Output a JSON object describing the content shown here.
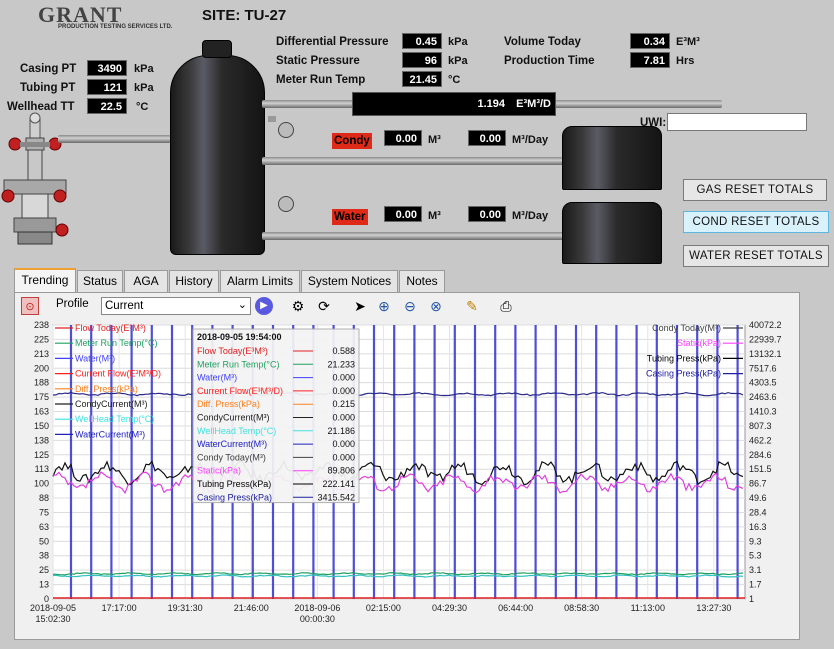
{
  "header": {
    "logo_text": "GRANT",
    "logo_sub": "PRODUCTION TESTING SERVICES LTD.",
    "site": "SITE: TU-27"
  },
  "wellhead": {
    "casing_pt": {
      "label": "Casing PT",
      "value": "3490",
      "unit": "kPa"
    },
    "tubing_pt": {
      "label": "Tubing PT",
      "value": "121",
      "unit": "kPa"
    },
    "wellhead_tt": {
      "label": "Wellhead TT",
      "value": "22.5",
      "unit": "°C"
    }
  },
  "meter": {
    "diff_pressure": {
      "label": "Differential Pressure",
      "value": "0.45",
      "unit": "kPa"
    },
    "static_pressure": {
      "label": "Static Pressure",
      "value": "96",
      "unit": "kPa"
    },
    "run_temp": {
      "label": "Meter Run Temp",
      "value": "21.45",
      "unit": "°C"
    },
    "volume_today": {
      "label": "Volume Today",
      "value": "0.34",
      "unit": "E³M³"
    },
    "production_time": {
      "label": "Production Time",
      "value": "7.81",
      "unit": "Hrs"
    },
    "flow_rate": {
      "value": "1.194",
      "unit": "E³M³/D"
    }
  },
  "condy": {
    "label": "Condy",
    "volume": "0.00",
    "volume_unit": "M³",
    "rate": "0.00",
    "rate_unit": "M³/Day"
  },
  "water": {
    "label": "Water",
    "volume": "0.00",
    "volume_unit": "M³",
    "rate": "0.00",
    "rate_unit": "M³/Day"
  },
  "uwi": {
    "label": "UWI:",
    "value": ""
  },
  "buttons": {
    "gas_reset": "GAS RESET TOTALS",
    "cond_reset": "COND RESET TOTALS",
    "water_reset": "WATER RESET TOTALS"
  },
  "tabs": [
    "Trending",
    "Status",
    "AGA",
    "History",
    "Alarm Limits",
    "System Notices",
    "Notes"
  ],
  "toolbar": {
    "profile_label": "Profile",
    "profile_value": "Current"
  },
  "chart_data": {
    "type": "line",
    "left_axis_ticks": [
      "238",
      "225",
      "213",
      "200",
      "188",
      "175",
      "163",
      "150",
      "138",
      "125",
      "113",
      "100",
      "88",
      "75",
      "63",
      "50",
      "38",
      "25",
      "13",
      "0"
    ],
    "right_axis_ticks": [
      "40072.2",
      "22939.7",
      "13132.1",
      "7517.6",
      "4303.5",
      "2463.6",
      "1410.3",
      "807.3",
      "462.2",
      "284.6",
      "151.5",
      "86.7",
      "49.6",
      "28.4",
      "16.3",
      "9.3",
      "5.3",
      "3.1",
      "1.7",
      "1"
    ],
    "x_ticks": [
      {
        "line1": "2018-09-05",
        "line2": "15:02:30"
      },
      {
        "line1": "17:17:00",
        "line2": ""
      },
      {
        "line1": "19:31:30",
        "line2": ""
      },
      {
        "line1": "21:46:00",
        "line2": ""
      },
      {
        "line1": "2018-09-06",
        "line2": "00:00:30"
      },
      {
        "line1": "02:15:00",
        "line2": ""
      },
      {
        "line1": "04:29:30",
        "line2": ""
      },
      {
        "line1": "06:44:00",
        "line2": ""
      },
      {
        "line1": "08:58:30",
        "line2": ""
      },
      {
        "line1": "11:13:00",
        "line2": ""
      },
      {
        "line1": "13:27:30",
        "line2": ""
      }
    ],
    "left_legend": [
      {
        "name": "Flow Today(E³M³)",
        "color": "#e02020"
      },
      {
        "name": "Meter Run Temp(°C)",
        "color": "#20a060"
      },
      {
        "name": "Water(M³)",
        "color": "#4040ff"
      },
      {
        "name": "Current Flow(E³M³/D)",
        "color": "#ff2020"
      },
      {
        "name": "Diff. Press(kPa)",
        "color": "#ff8020"
      },
      {
        "name": "CondyCurrent(M³)",
        "color": "#202020"
      },
      {
        "name": "WellHead Temp(°C)",
        "color": "#40e0e0"
      },
      {
        "name": "WaterCurrent(M³)",
        "color": "#2020c0"
      }
    ],
    "right_legend": [
      {
        "name": "Condy Today(M³)",
        "color": "#404040"
      },
      {
        "name": "Static(kPa)",
        "color": "#ff40ff"
      },
      {
        "name": "Tubing Press(kPa)",
        "color": "#000000"
      },
      {
        "name": "Casing Press(kPa)",
        "color": "#2020a0"
      }
    ],
    "tooltip": {
      "timestamp": "2018-09-05 19:54:00",
      "rows": [
        {
          "name": "Flow Today(E³M³)",
          "value": "0.588",
          "color": "#e02020"
        },
        {
          "name": "Meter Run Temp(°C)",
          "value": "21.233",
          "color": "#20a060"
        },
        {
          "name": "Water(M³)",
          "value": "0.000",
          "color": "#4040ff"
        },
        {
          "name": "Current Flow(E³M³/D)",
          "value": "0.000",
          "color": "#ff2020"
        },
        {
          "name": "Diff. Press(kPa)",
          "value": "0.215",
          "color": "#ff8020"
        },
        {
          "name": "CondyCurrent(M³)",
          "value": "0.000",
          "color": "#202020"
        },
        {
          "name": "WellHead Temp(°C)",
          "value": "21.186",
          "color": "#40e0e0"
        },
        {
          "name": "WaterCurrent(M³)",
          "value": "0.000",
          "color": "#2020c0"
        },
        {
          "name": "Condy Today(M³)",
          "value": "0.000",
          "color": "#404040"
        },
        {
          "name": "Static(kPa)",
          "value": "89.806",
          "color": "#ff40ff"
        },
        {
          "name": "Tubing Press(kPa)",
          "value": "222.141",
          "color": "#000000"
        },
        {
          "name": "Casing Press(kPa)",
          "value": "3415.542",
          "color": "#2020a0"
        }
      ]
    },
    "series": [
      {
        "name": "Casing Press(kPa)",
        "color": "#2a2a8a",
        "level": 178
      },
      {
        "name": "Tubing Press(kPa)",
        "color": "#111111",
        "level": 110
      },
      {
        "name": "Static(kPa)",
        "color": "#e040e0",
        "level": 101
      },
      {
        "name": "WellHead Temp(°C)",
        "color": "#30c0c0",
        "level": 20
      },
      {
        "name": "Meter Run Temp(°C)",
        "color": "#20a060",
        "level": 22
      }
    ],
    "ylim": [
      0,
      238
    ]
  }
}
